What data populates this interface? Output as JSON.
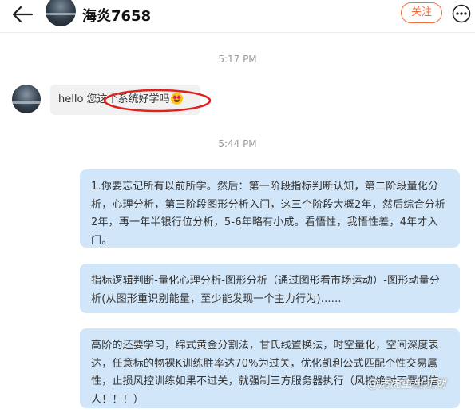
{
  "header": {
    "title": "海炎7658",
    "follow_label": "关注"
  },
  "conversation": {
    "timestamp_1": "5:17 PM",
    "incoming_message": "hello 您这个系统好学吗",
    "incoming_emoji": "star-struck-emoji",
    "timestamp_2": "5:44 PM",
    "outgoing_messages": [
      "1.你要忘记所有以前所学。然后：第一阶段指标判断认知，第二阶段量化分析，心理分析，第三阶段图形分析入门，这三个阶段大概2年，然后综合分析2年，再一年半银行位分析，5-6年略有小成。看悟性，我悟性差，4年才入门。",
      "指标逻辑判断-量化心理分析-图形分析（通过图形看市场运动）-图形动量分析(从图形重识别能量，至少能发现一个主力行为)......",
      "高阶的还要学习，绵式黄金分割法，甘氏线置换法，时空量化，空间深度表达，任意标的物裸K训练胜率达70%为过关，优化凯利公式匹配个性交易属性，止损风控训练如果不过关，就强制三方服务器执行（风控绝对不要相信人！！！）"
    ]
  },
  "watermark": "@虎虎重出江湖",
  "icons": {
    "back": "back-arrow-icon",
    "more": "more-options-icon"
  },
  "colors": {
    "accent": "#f36c3e",
    "outgoing_bubble": "#d2e6f9",
    "incoming_bubble": "#f1f1f1",
    "annotation": "#e0201c"
  }
}
